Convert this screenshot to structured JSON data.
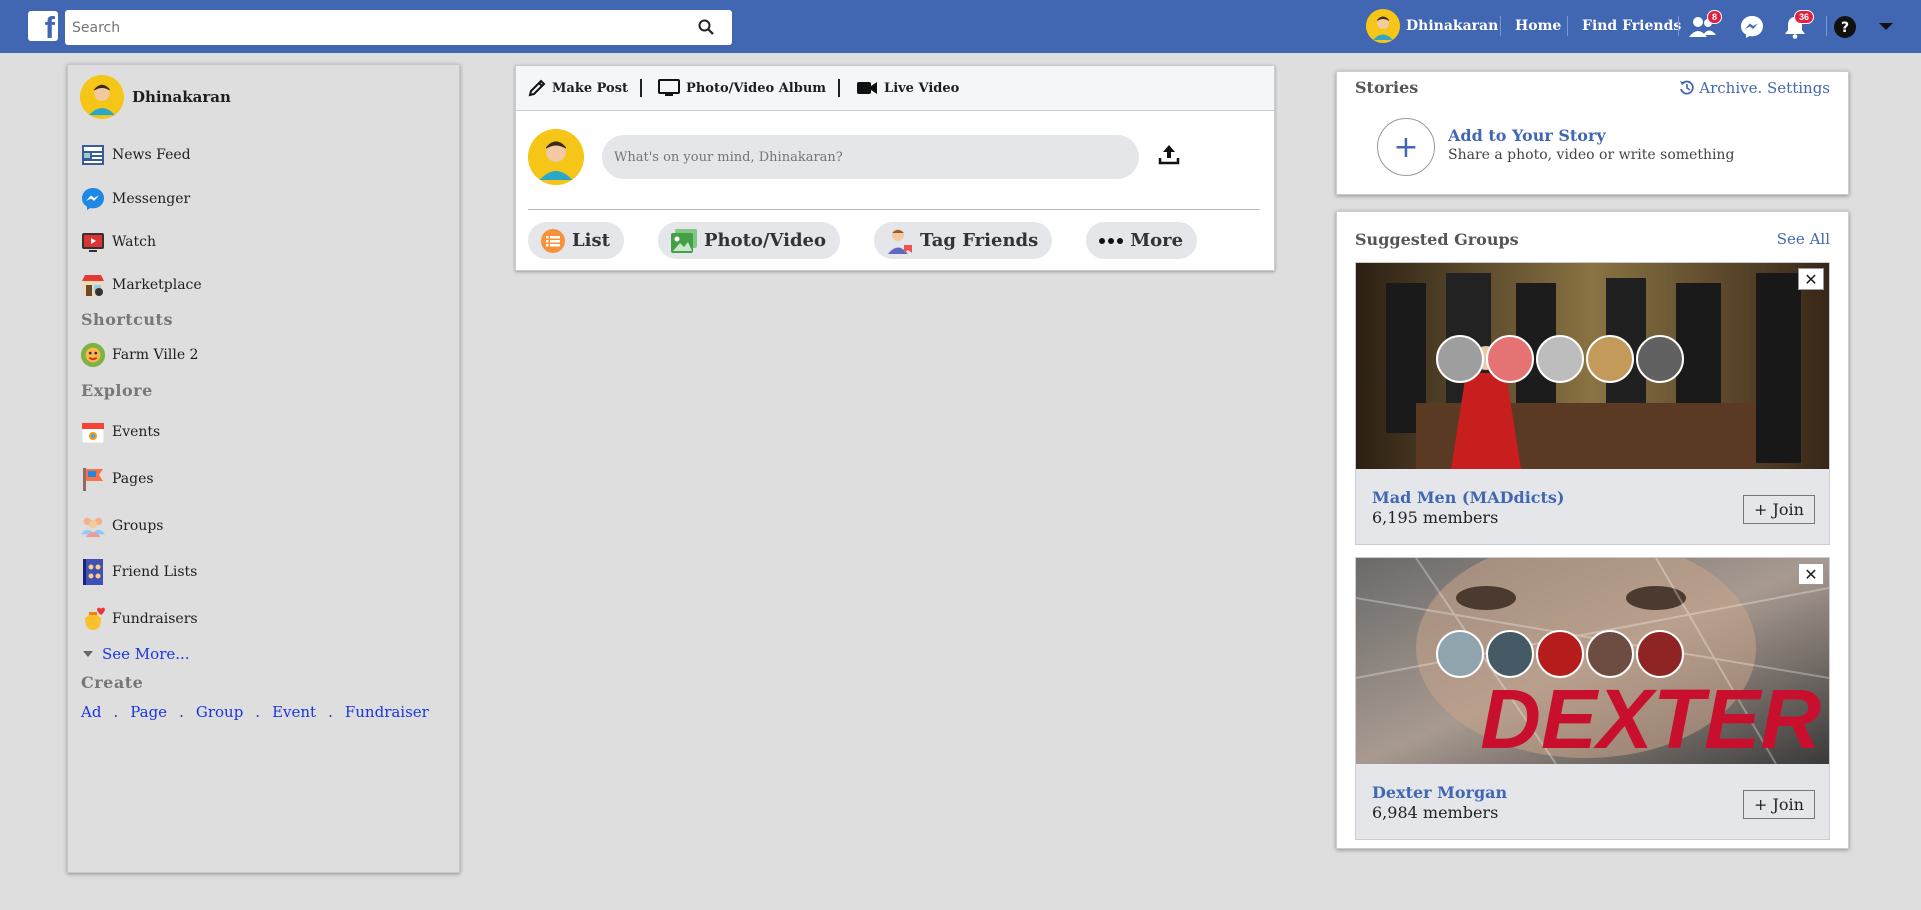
{
  "topbar": {
    "logo": "f",
    "search_placeholder": "Search",
    "profile_name": "Dhinakaran",
    "home_label": "Home",
    "find_friends_label": "Find Friends",
    "friend_requests_count": "8",
    "notifications_count": "36",
    "icons": [
      "search-icon",
      "friends-icon",
      "messenger-icon",
      "bell-icon",
      "help-icon",
      "caret-down-icon"
    ],
    "brand_color": "#4267b2"
  },
  "sidebar": {
    "user_name": "Dhinakaran",
    "items": [
      {
        "label": "News Feed",
        "icon": "news-feed-icon"
      },
      {
        "label": "Messenger",
        "icon": "messenger-icon"
      },
      {
        "label": "Watch",
        "icon": "watch-icon"
      },
      {
        "label": "Marketplace",
        "icon": "marketplace-icon"
      }
    ],
    "shortcuts_heading": "Shortcuts",
    "shortcuts": [
      {
        "label": "Farm Ville 2",
        "icon": "farmville-icon"
      }
    ],
    "explore_heading": "Explore",
    "explore": [
      {
        "label": "Events",
        "icon": "events-icon"
      },
      {
        "label": "Pages",
        "icon": "pages-icon"
      },
      {
        "label": "Groups",
        "icon": "groups-icon"
      },
      {
        "label": "Friend Lists",
        "icon": "friend-lists-icon"
      },
      {
        "label": "Fundraisers",
        "icon": "fundraisers-icon"
      }
    ],
    "see_more": "See More...",
    "create_heading": "Create",
    "create_links": [
      "Ad",
      "Page",
      "Group",
      "Event",
      "Fundraiser"
    ],
    "separator": "."
  },
  "composer": {
    "tabs": [
      "Make Post",
      "Photo/Video Album",
      "Live Video"
    ],
    "placeholder": "What's on your mind, Dhinakaran?",
    "actions": [
      "List",
      "Photo/Video",
      "Tag Friends",
      "More"
    ]
  },
  "stories": {
    "heading": "Stories",
    "archive_link": "Archive. Settings",
    "add_title": "Add to Your Story",
    "add_subtitle": "Share a photo, video or write something"
  },
  "suggested_groups": {
    "heading": "Suggested Groups",
    "see_all": "See All",
    "groups": [
      {
        "name": "Mad Men (MADdicts)",
        "members": "6,195 members",
        "join_label": "+ Join",
        "close": "✕"
      },
      {
        "name": "Dexter Morgan",
        "members": "6,984 members",
        "join_label": "+ Join",
        "close": "✕",
        "image_text": "DEXTER"
      }
    ]
  }
}
